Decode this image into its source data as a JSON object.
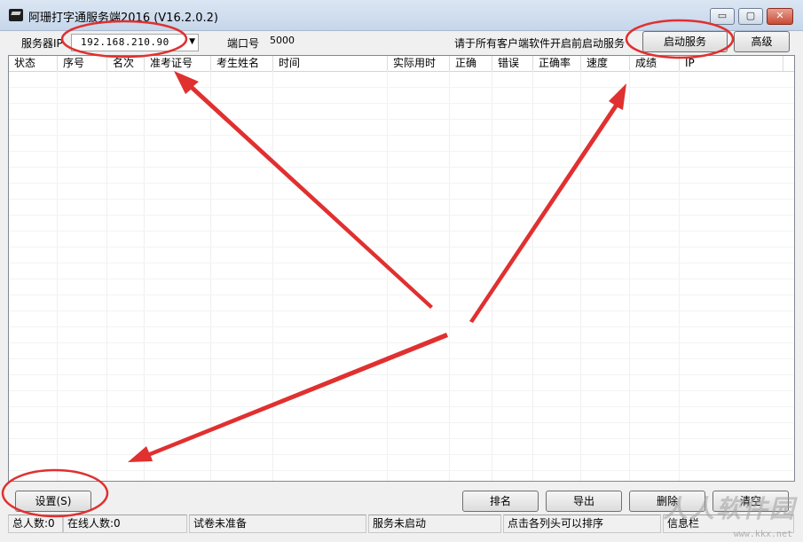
{
  "window": {
    "title": "阿珊打字通服务端2016 (V16.2.0.2)",
    "minimize_symbol": "▭",
    "maximize_symbol": "▢",
    "close_symbol": "✕"
  },
  "toolbar": {
    "server_ip_label": "服务器IP",
    "server_ip_value": "192.168.210.90",
    "port_label": "端口号",
    "port_value": "5000",
    "hint": "请于所有客户端软件开启前启动服务",
    "start_service_button": "启动服务",
    "advanced_button": "高级"
  },
  "table": {
    "columns": [
      "状态",
      "序号",
      "名次",
      "准考证号",
      "考生姓名",
      "时间",
      "实际用时",
      "正确",
      "错误",
      "正确率",
      "速度",
      "成绩",
      "IP"
    ],
    "rows": []
  },
  "bottom_buttons": {
    "settings": "设置(S)",
    "rank": "排名",
    "export": "导出",
    "delete": "删除",
    "clear": "清空"
  },
  "statusbar": {
    "total": "总人数:0",
    "online": "在线人数:0",
    "paper_status": "试卷未准备",
    "service_status": "服务未启动",
    "sort_hint": "点击各列头可以排序",
    "info": "信息栏"
  },
  "watermark": {
    "text": "人人软件园",
    "url": "www.kkx.net"
  },
  "annotation_color": "#e03030"
}
